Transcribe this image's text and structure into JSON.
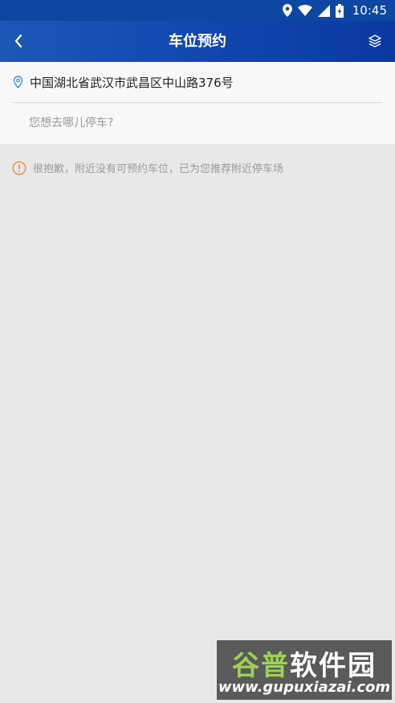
{
  "status_bar": {
    "time": "10:45"
  },
  "header": {
    "title": "车位预约",
    "back_icon": "chevron-left-icon",
    "layers_icon": "layers-icon"
  },
  "search": {
    "current_location": "中国湖北省武汉市武昌区中山路376号",
    "destination_placeholder": "您想去哪儿停车?",
    "destination_value": ""
  },
  "notice": {
    "text": "很抱歉，附近没有可预约车位，已为您推荐附近停车场",
    "icon": "warning-icon",
    "color": "#f08c2e"
  },
  "watermark": {
    "title_a": "谷普",
    "title_b": "软件园",
    "url": "www.gupuxiazai.com"
  },
  "colors": {
    "header": "#1247b0",
    "accent_pin": "#3a8ee6",
    "background": "#e8e8e8"
  }
}
